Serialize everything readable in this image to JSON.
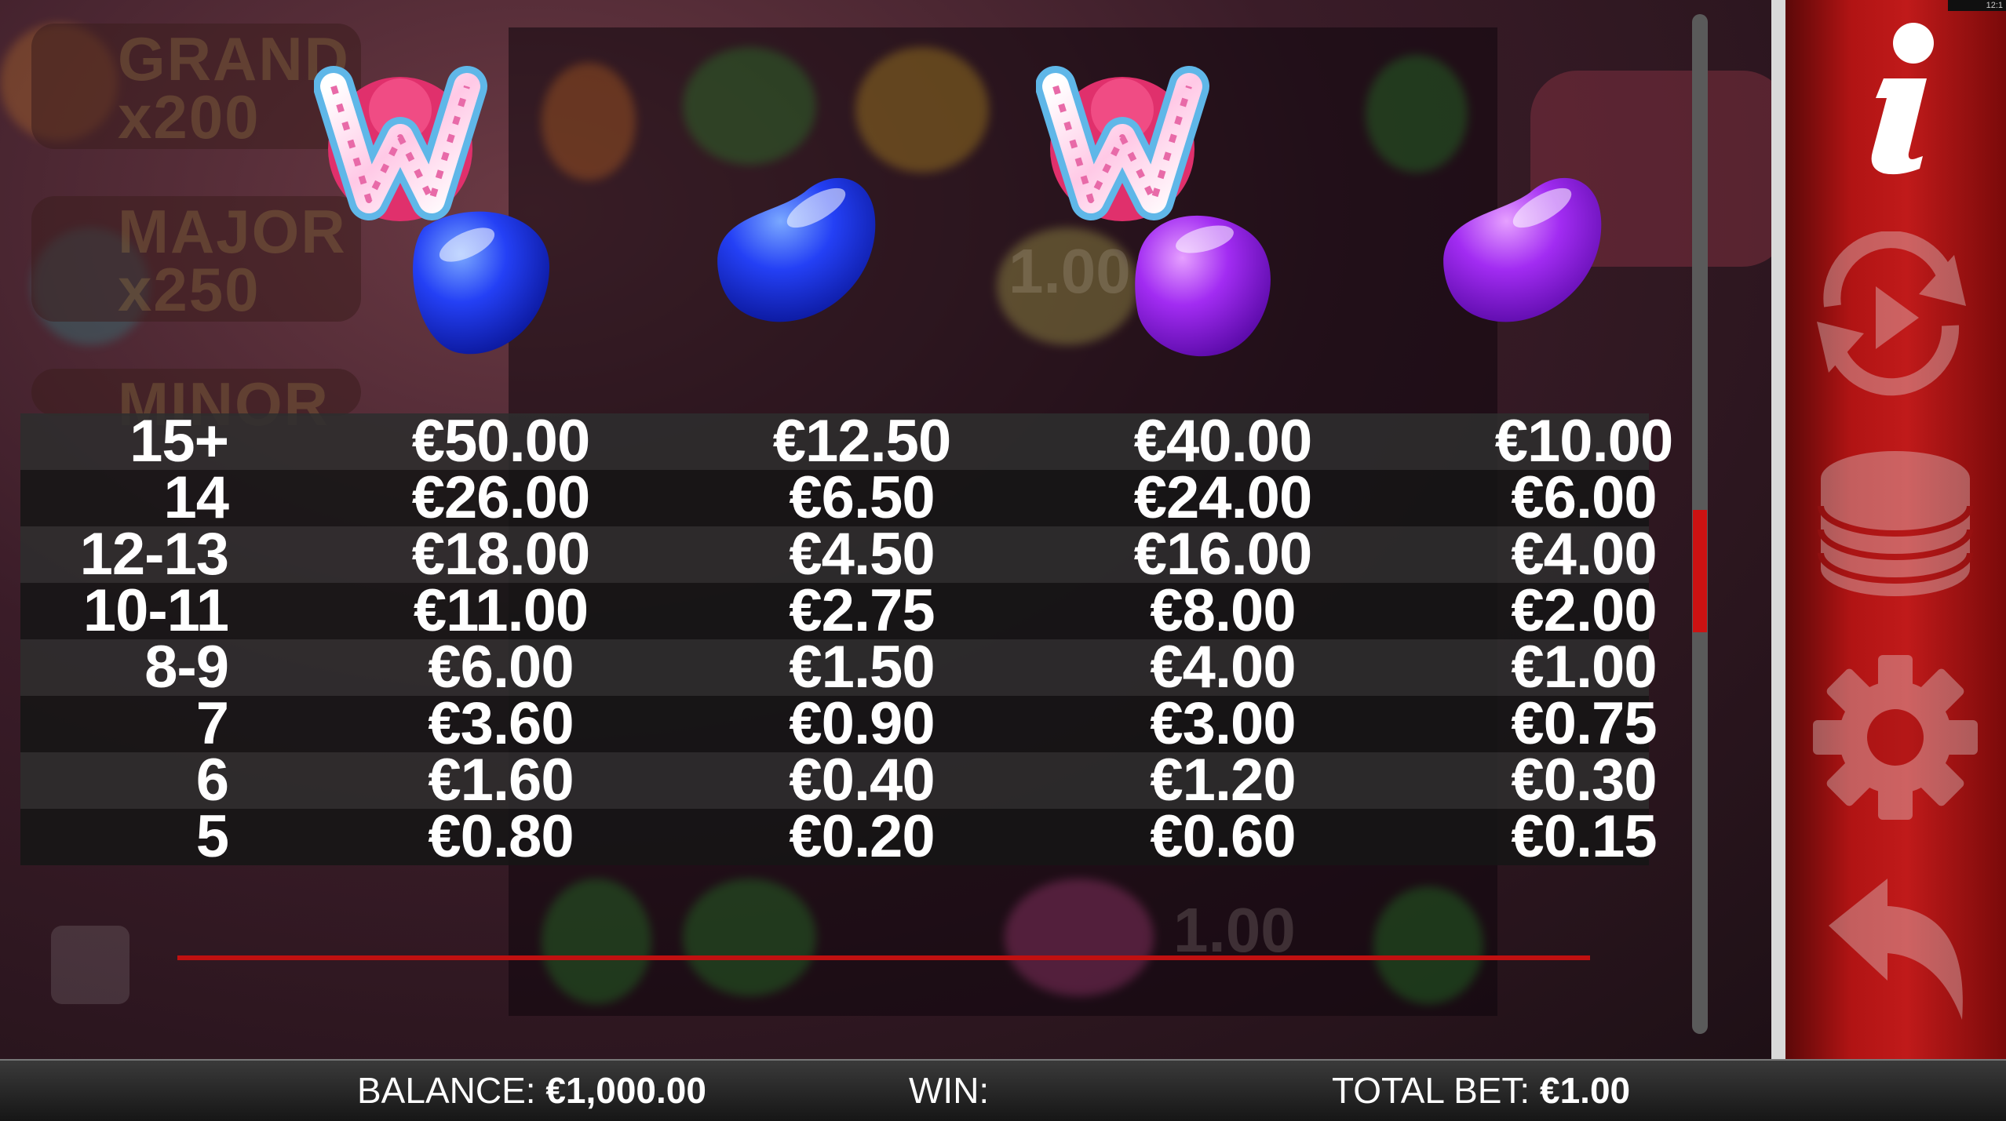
{
  "paytable": {
    "rows": [
      {
        "count": "15+",
        "values": [
          "€50.00",
          "€12.50",
          "€40.00",
          "€10.00"
        ]
      },
      {
        "count": "14",
        "values": [
          "€26.00",
          "€6.50",
          "€24.00",
          "€6.00"
        ]
      },
      {
        "count": "12-13",
        "values": [
          "€18.00",
          "€4.50",
          "€16.00",
          "€4.00"
        ]
      },
      {
        "count": "10-11",
        "values": [
          "€11.00",
          "€2.75",
          "€8.00",
          "€2.00"
        ]
      },
      {
        "count": "8-9",
        "values": [
          "€6.00",
          "€1.50",
          "€4.00",
          "€1.00"
        ]
      },
      {
        "count": "7",
        "values": [
          "€3.60",
          "€0.90",
          "€3.00",
          "€0.75"
        ]
      },
      {
        "count": "6",
        "values": [
          "€1.60",
          "€0.40",
          "€1.20",
          "€0.30"
        ]
      },
      {
        "count": "5",
        "values": [
          "€0.80",
          "€0.20",
          "€0.60",
          "€0.15"
        ]
      }
    ],
    "symbols": [
      "wild-plus-blue-jellybean-icon",
      "blue-jellybean-icon",
      "wild-plus-purple-jellybean-icon",
      "purple-jellybean-icon"
    ]
  },
  "background": {
    "jackpots": [
      {
        "name": "GRAND",
        "mult": "x200"
      },
      {
        "name": "MAJOR",
        "mult": "x250"
      },
      {
        "name": "MINOR",
        "mult": ""
      }
    ],
    "reel_values": [
      "1.00",
      "1.00"
    ]
  },
  "sidebar": {
    "icons": [
      "info-icon",
      "autoplay-icon",
      "coins-stack-icon",
      "settings-gear-icon",
      "back-arrow-icon"
    ]
  },
  "status_bar": {
    "time": "12:1"
  },
  "footer": {
    "balance_label": "BALANCE:",
    "balance_value": "€1,000.00",
    "win_label": "WIN:",
    "win_value": "",
    "total_bet_label": "TOTAL BET:",
    "total_bet_value": "€1.00"
  },
  "colors": {
    "accent_red": "#c01010",
    "jelly_blue": "#1f3cf0",
    "jelly_purple": "#a52cf0",
    "row_light": "#2d2d2d",
    "row_dark": "#161616"
  }
}
